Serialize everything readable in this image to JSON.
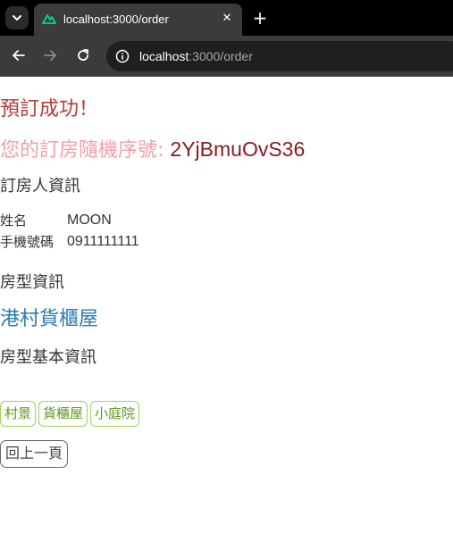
{
  "browser": {
    "tab_title": "localhost:3000/order",
    "tab_close_glyph": "✕",
    "new_tab_glyph": "+",
    "url_host": "localhost",
    "url_rest": ":3000/order",
    "icons": {
      "tab_list": "chevron-down-icon",
      "favicon": "nuxt-logo-icon",
      "back": "arrow-left-icon",
      "forward": "arrow-right-icon",
      "reload": "reload-icon",
      "site_info": "info-icon"
    }
  },
  "page": {
    "success_title": "預訂成功！",
    "order_label": "您的訂房隨機序號: ",
    "order_number": "2YjBmuOvS36",
    "booker_heading": "訂房人資訊",
    "booker": [
      {
        "key": "姓名",
        "value": "MOON"
      },
      {
        "key": "手機號碼",
        "value": "0911111111"
      }
    ],
    "room_heading": "房型資訊",
    "room_name": "港村貨櫃屋",
    "room_basic_heading": "房型基本資訊",
    "tags": [
      "村景",
      "貨櫃屋",
      "小庭院"
    ],
    "back_button": "回上一頁"
  },
  "colors": {
    "success": "#b23b3b",
    "order_label": "#f0a0a8",
    "order_number": "#8b1a1a",
    "room_name": "#2a7bb0",
    "tag": "#5a9a1e",
    "tag_border": "#9ed15c"
  }
}
